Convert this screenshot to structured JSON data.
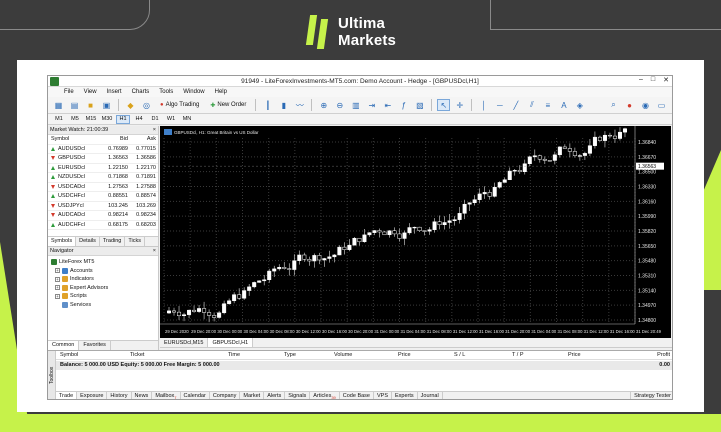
{
  "brand": {
    "line1": "Ultima",
    "line2": "Markets"
  },
  "window": {
    "title": "91949 - LiteForexInvestments-MT5.com: Demo Account - Hedge - [GBPUSDcl,H1]",
    "controls": [
      "–",
      "□",
      "✕"
    ]
  },
  "menu": [
    "File",
    "View",
    "Insert",
    "Charts",
    "Tools",
    "Window",
    "Help"
  ],
  "toolbar": {
    "algo_trading": "Algo Trading",
    "new_order": "New Order"
  },
  "timeframes": [
    "M1",
    "M5",
    "M15",
    "M30",
    "H1",
    "H4",
    "D1",
    "W1",
    "MN"
  ],
  "active_timeframe": "H1",
  "market_watch": {
    "title": "Market Watch: 21:00:39",
    "columns": [
      "Symbol",
      "Bid",
      "Ask"
    ],
    "rows": [
      {
        "symbol": "AUDUSDcl",
        "bid": "0.76989",
        "ask": "0.77015",
        "dir": "up"
      },
      {
        "symbol": "GBPUSDcl",
        "bid": "1.36563",
        "ask": "1.36586",
        "dir": "down"
      },
      {
        "symbol": "EURUSDcl",
        "bid": "1.22150",
        "ask": "1.22170",
        "dir": "up"
      },
      {
        "symbol": "NZDUSDcl",
        "bid": "0.71868",
        "ask": "0.71891",
        "dir": "up"
      },
      {
        "symbol": "USDCADcl",
        "bid": "1.27563",
        "ask": "1.27588",
        "dir": "down"
      },
      {
        "symbol": "USDCHFcl",
        "bid": "0.88551",
        "ask": "0.88574",
        "dir": "up"
      },
      {
        "symbol": "USDJPYcl",
        "bid": "103.245",
        "ask": "103.269",
        "dir": "down"
      },
      {
        "symbol": "AUDCADcl",
        "bid": "0.98214",
        "ask": "0.98234",
        "dir": "down"
      },
      {
        "symbol": "AUDCHFcl",
        "bid": "0.68175",
        "ask": "0.68203",
        "dir": "up"
      }
    ],
    "tabs": [
      "Symbols",
      "Details",
      "Trading",
      "Ticks"
    ]
  },
  "navigator": {
    "title": "Navigator",
    "root": "LiteForex MT5",
    "items": [
      "Accounts",
      "Indicators",
      "Expert Advisors",
      "Scripts",
      "Services"
    ],
    "tabs": [
      "Common",
      "Favorites"
    ]
  },
  "chart": {
    "label": "GBPUSDcl, H1: Great Britain vs US Dollar",
    "price_ticks": [
      "1.36840",
      "1.36670",
      "1.36500",
      "1.36330",
      "1.36160",
      "1.35990",
      "1.35820",
      "1.35650",
      "1.35480",
      "1.35310",
      "1.35140",
      "1.34970",
      "1.34800"
    ],
    "current_price": "1.36563",
    "time_ticks": [
      "29 Dec 2020",
      "29 Dec 20:00",
      "30 Dec 00:00",
      "30 Dec 04:00",
      "30 Dec 08:00",
      "30 Dec 12:00",
      "30 Dec 16:00",
      "30 Dec 20:00",
      "31 Dec 00:00",
      "31 Dec 04:00",
      "31 Dec 08:00",
      "31 Dec 12:00",
      "31 Dec 16:00",
      "31 Dec 20:00",
      "31 Dec 04:00",
      "31 Dec 08:00",
      "31 Dec 12:00",
      "31 Dec 16:00",
      "31 Dec 20:49"
    ],
    "tabs": [
      "EURUSDcl,M15",
      "GBPUSDcl,H1"
    ],
    "active_tab": "GBPUSDcl,H1",
    "colors": {
      "background": "#000000",
      "grid": "#3a3a3a",
      "bull": "#ffffff",
      "bear": "#000000",
      "wick": "#e0e0e0"
    }
  },
  "toolbox": {
    "side_label": "Toolbox",
    "columns": [
      "Symbol",
      "Ticket",
      "Time",
      "Type",
      "Volume",
      "Price",
      "S / L",
      "T / P",
      "Price",
      "Profit"
    ],
    "balance_text": "Balance: 5 000.00 USD  Equity: 5 000.00  Free Margin: 5 000.00",
    "balance_value": "0.00",
    "tabs": [
      "Trade",
      "Exposure",
      "History",
      "News",
      "Mailbox",
      "Calendar",
      "Company",
      "Market",
      "Alerts",
      "Signals",
      "Articles",
      "Code Base",
      "VPS",
      "Experts",
      "Journal"
    ],
    "mailbox_badge": "7",
    "articles_badge": "39",
    "strategy_tester": "Strategy Tester"
  }
}
